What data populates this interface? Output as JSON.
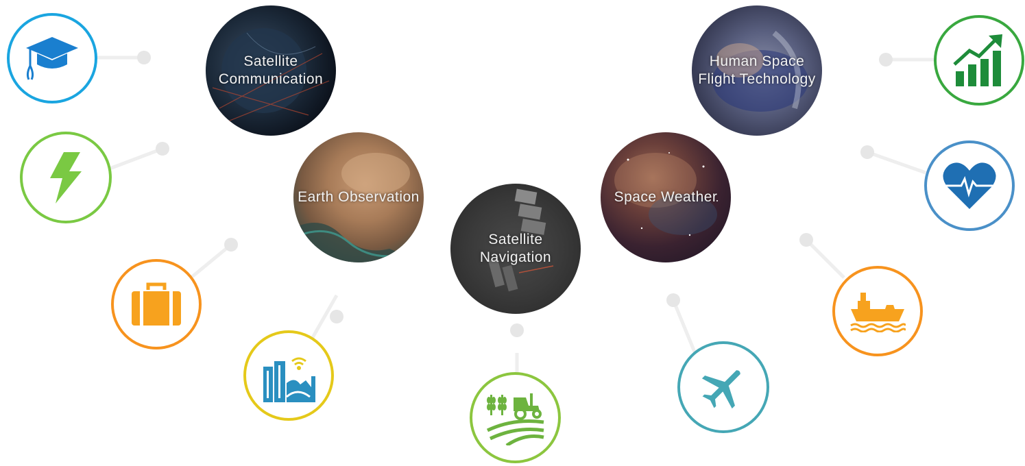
{
  "topics": {
    "satcom": {
      "label": "Satellite Communication"
    },
    "earthobs": {
      "label": "Earth Observation"
    },
    "satnav": {
      "label": "Satellite Navigation"
    },
    "spaceweather": {
      "label": "Space Weather"
    },
    "humanspace": {
      "label": "Human Space Flight Technology"
    }
  },
  "sectors": [
    {
      "icon": "graduation-cap-icon",
      "color": "#1aa5e0"
    },
    {
      "icon": "lightning-bolt-icon",
      "color": "#7ac943"
    },
    {
      "icon": "suitcase-icon",
      "color": "#f7931e"
    },
    {
      "icon": "smart-city-icon",
      "color": "#e5c91a"
    },
    {
      "icon": "agriculture-tractor-icon",
      "color": "#8cc63f"
    },
    {
      "icon": "airplane-icon",
      "color": "#45a7b5"
    },
    {
      "icon": "cargo-ship-icon",
      "color": "#f7931e"
    },
    {
      "icon": "heart-pulse-icon",
      "color": "#4a90c8"
    },
    {
      "icon": "growth-chart-icon",
      "color": "#39a83f"
    }
  ]
}
